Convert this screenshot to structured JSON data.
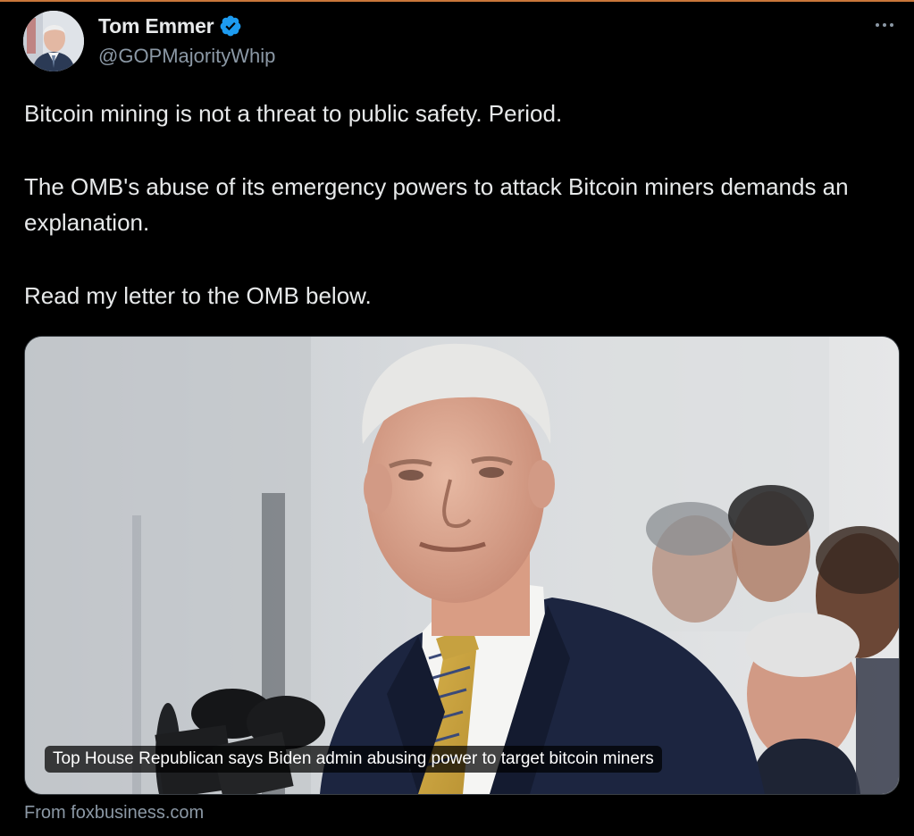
{
  "author": {
    "display_name": "Tom Emmer",
    "handle": "@GOPMajorityWhip",
    "verified": true,
    "verified_color": "#1d9bf0"
  },
  "menu": {
    "icon": "more-horizontal-icon"
  },
  "tweet": {
    "paragraphs": [
      "Bitcoin mining is not a threat to public safety. Period.",
      "The OMB's abuse of its emergency powers to attack Bitcoin miners demands an explanation.",
      "Read my letter to the OMB below."
    ]
  },
  "link_card": {
    "title": "Top House Republican says Biden admin abusing power to target bitcoin miners",
    "source": "From foxbusiness.com"
  },
  "colors": {
    "background": "#000000",
    "text_primary": "#e7e9ea",
    "text_secondary": "#8b98a5"
  }
}
